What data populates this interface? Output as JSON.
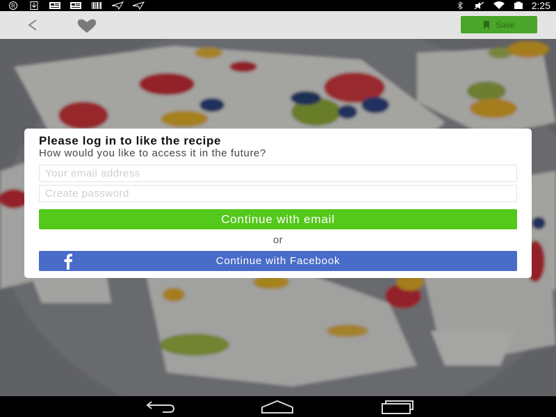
{
  "status_bar": {
    "time": "2:25",
    "left_icons": [
      "r-circle-icon",
      "download-icon",
      "news-icon",
      "news-icon-2",
      "barcode-icon",
      "send-icon",
      "send-icon-2"
    ],
    "right_icons": [
      "bluetooth-icon",
      "mute-icon",
      "wifi-icon",
      "battery-icon"
    ]
  },
  "app_bar": {
    "save_label": "Save",
    "back_icon": "chevron-left-icon",
    "like_icon": "heart-icon"
  },
  "dialog": {
    "title": "Please log in to like the recipe",
    "subtitle": "How would you like to access it in the future?",
    "email_placeholder": "Your email address",
    "password_placeholder": "Create password",
    "email_button": "Continue with email",
    "or": "or",
    "facebook_button": "Continue with Facebook"
  },
  "colors": {
    "save_green": "#49a62a",
    "email_button_green": "#54c81b",
    "facebook_blue": "#4a6cc9",
    "app_bar_bg": "#e4e4e4"
  },
  "nav_bar": {
    "icons": [
      "back-nav-icon",
      "home-nav-icon",
      "recents-nav-icon"
    ]
  }
}
